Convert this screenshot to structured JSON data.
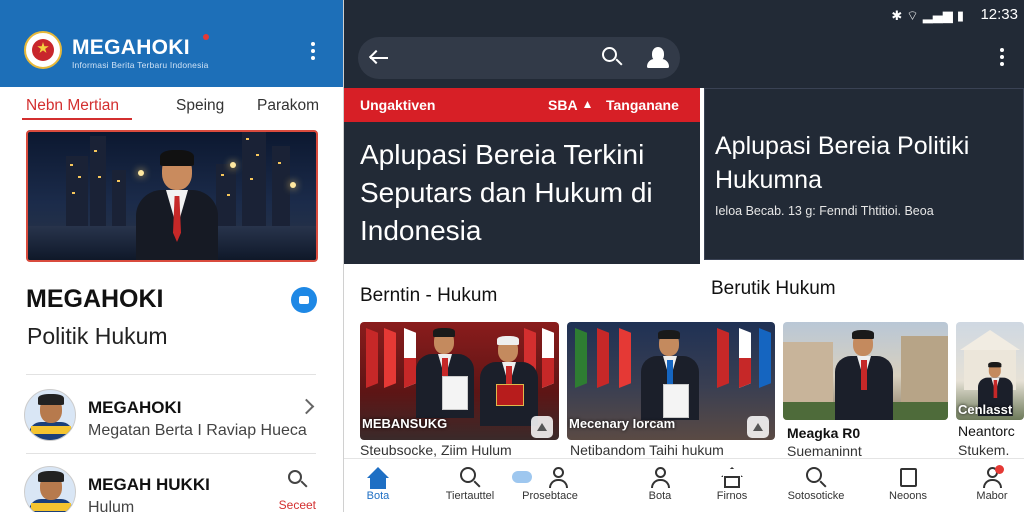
{
  "left": {
    "header": {
      "app_name": "MEGAHOKI",
      "tagline": "Informasi Berita Terbaru Indonesia",
      "brand_color": "#1d6fb8"
    },
    "tabs": [
      "Nebn Mertian",
      "Speing",
      "Parakom"
    ],
    "hero": {
      "alt": "Politician standing in front of a city skyline at night"
    },
    "brand_title": "MEGAHOKI",
    "brand_subtitle": "Politik Hukum",
    "items": [
      {
        "title": "MEGAHOKI",
        "subtitle": "Megatan Berta I Raviap Hueca"
      },
      {
        "title": "MEGAH HUKKI",
        "subtitle": "Hulum",
        "action": "Seceet"
      }
    ]
  },
  "right": {
    "status": {
      "time": "12:33",
      "icons": "✱ ⌔ ▂▄▆ ▮"
    },
    "card1": {
      "tag_left": "Ungaktiven",
      "tag_right": "SBA",
      "tag_right2": "Tanganane",
      "title": "Aplupasi Bereia Terkini Seputars dan Hukum di Indonesia",
      "accent": "#d71f26"
    },
    "card2": {
      "title": "Aplupasi Bereia Politiki Hukumna",
      "meta": "Ieloa Becab. 13 g: Fenndi Thtitioi. Beoa"
    },
    "section_left": "Berntin - Hukum",
    "section_right": "Berutik Hukum",
    "thumbs": [
      {
        "caption": "MEBANSUKG",
        "title": "",
        "subtitle": "Steubsocke, Ziim Hulum"
      },
      {
        "caption": "Mecenary Iorcam",
        "title": "",
        "subtitle": "Netibandom Taihi hukum"
      },
      {
        "caption": "",
        "title": "Meagka R0",
        "subtitle": "Suemaninnt"
      },
      {
        "caption": "Cenlasst",
        "title": "Neantorc",
        "subtitle": "Stukem."
      }
    ],
    "nav": [
      {
        "label": "Bota",
        "icon": "home-icon",
        "active": true
      },
      {
        "label": "Tiertauttel",
        "icon": "search-icon"
      },
      {
        "label": "Prosebtace",
        "icon": "user-icon"
      },
      {
        "label": "Bota",
        "icon": "user-icon"
      },
      {
        "label": "Firnos",
        "icon": "house-icon"
      },
      {
        "label": "Sotosoticke",
        "icon": "search-icon"
      },
      {
        "label": "Neoons",
        "icon": "box-icon"
      },
      {
        "label": "Mabor",
        "icon": "account-icon"
      }
    ]
  }
}
